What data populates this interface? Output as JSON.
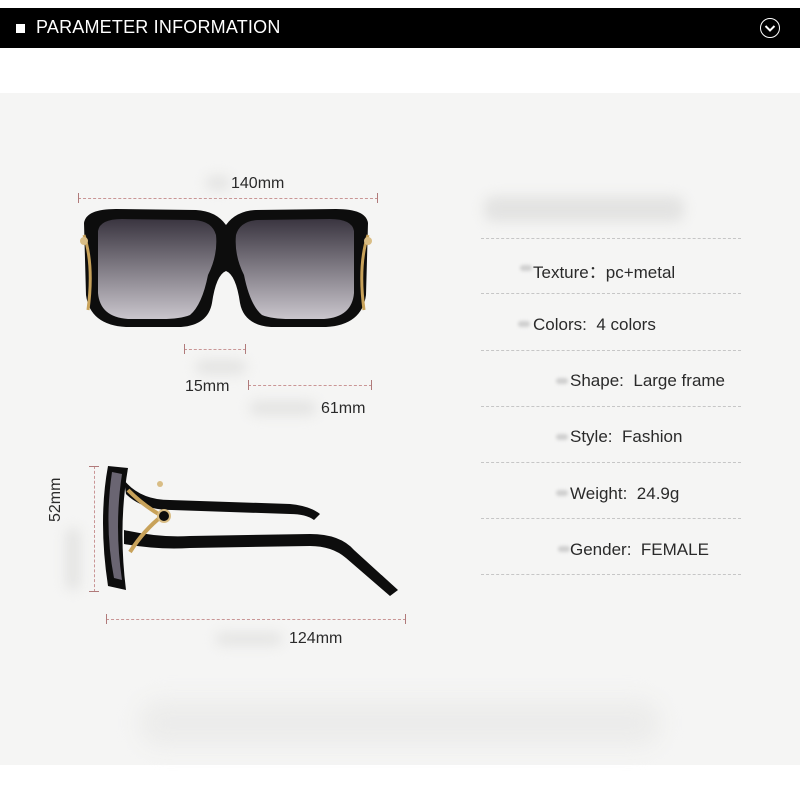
{
  "header": {
    "title": "PARAMETER INFORMATION",
    "toggle_icon": "chevron-down-circle-icon"
  },
  "dimensions": {
    "total_width": "140mm",
    "bridge": "15mm",
    "lens_width": "61mm",
    "lens_height": "52mm",
    "temple_length": "124mm"
  },
  "specs": [
    {
      "label": "Texture",
      "separator": "：",
      "value": "pc+metal"
    },
    {
      "label": "Colors",
      "separator": ":",
      "value": "4 colors"
    },
    {
      "label": "Shape",
      "separator": ":",
      "value": "Large frame"
    },
    {
      "label": "Style",
      "separator": ":",
      "value": "Fashion"
    },
    {
      "label": "Weight",
      "separator": ":",
      "value": "24.9g"
    },
    {
      "label": "Gender",
      "separator": ":",
      "value": "FEMALE"
    }
  ],
  "colors": {
    "frame": "#0d0d0d",
    "lens": "#5a5563",
    "gold_accent": "#c8a25a",
    "dim_line": "#c99595",
    "header_bg": "#000000"
  }
}
